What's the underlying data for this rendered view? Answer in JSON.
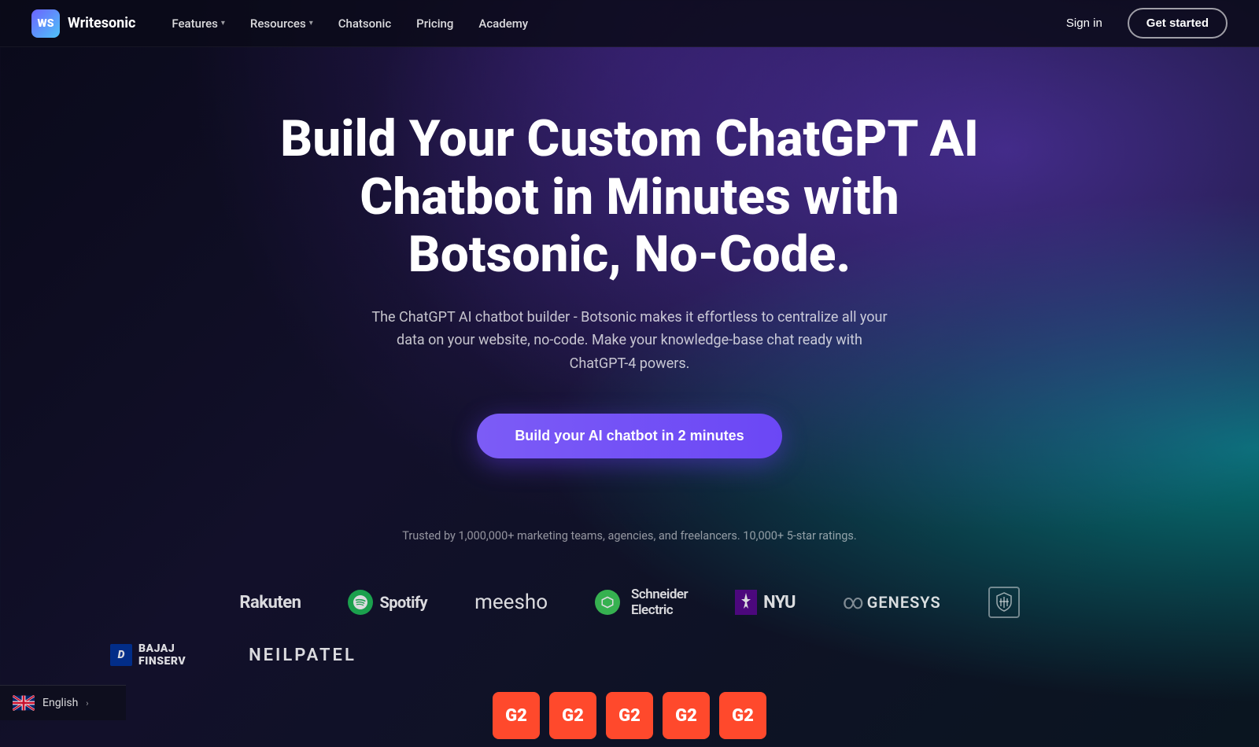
{
  "brand": {
    "logo_letters": "WS",
    "name": "Writesonic"
  },
  "nav": {
    "links": [
      {
        "label": "Features",
        "has_dropdown": true
      },
      {
        "label": "Resources",
        "has_dropdown": true
      },
      {
        "label": "Chatsonic",
        "has_dropdown": false
      },
      {
        "label": "Pricing",
        "has_dropdown": false
      },
      {
        "label": "Academy",
        "has_dropdown": false
      }
    ],
    "signin_label": "Sign in",
    "getstarted_label": "Get started"
  },
  "hero": {
    "title": "Build Your Custom ChatGPT AI Chatbot in Minutes with Botsonic, No-Code.",
    "subtitle": "The ChatGPT AI chatbot builder - Botsonic makes it effortless to centralize all your data on your website, no-code. Make your knowledge-base chat ready with ChatGPT-4 powers.",
    "cta_label": "Build your AI chatbot in 2 minutes"
  },
  "trust": {
    "text": "Trusted by 1,000,000+ marketing teams, agencies, and freelancers. 10,000+ 5-star ratings."
  },
  "logos": {
    "row1": [
      {
        "name": "Rakuten",
        "type": "text"
      },
      {
        "name": "Spotify",
        "type": "icon+text"
      },
      {
        "name": "meesho",
        "type": "text"
      },
      {
        "name": "Schneider Electric",
        "type": "icon+text"
      },
      {
        "name": "NYU",
        "type": "icon+text"
      },
      {
        "name": "GENESYS",
        "type": "symbol+text"
      },
      {
        "name": "Shield",
        "type": "shield"
      }
    ],
    "row2": [
      {
        "name": "BAJAJ FINSERV",
        "type": "icon+text"
      },
      {
        "name": "NEILPATEL",
        "type": "text"
      }
    ]
  },
  "language": {
    "label": "English",
    "chevron": "›"
  },
  "g2_badges": [
    "G2",
    "G2",
    "G2",
    "G2",
    "G2"
  ]
}
